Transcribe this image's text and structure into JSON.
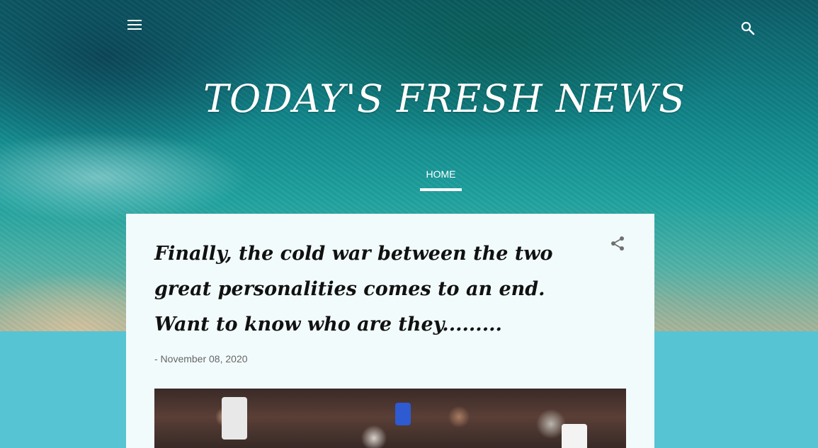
{
  "header": {
    "menu_icon": "hamburger-menu-icon",
    "search_icon": "search-icon",
    "site_title": "TODAY'S FRESH NEWS",
    "nav": [
      {
        "label": "HOME",
        "active": true
      }
    ]
  },
  "post": {
    "title": "Finally, the cold war between the two great personalities comes to an end. Want to know who are they.........",
    "date": "- November 08, 2020",
    "share_icon": "share-icon"
  },
  "colors": {
    "page_background": "#57c4d3",
    "card_background": "#f2fbfc",
    "header_text": "#ffffff"
  }
}
